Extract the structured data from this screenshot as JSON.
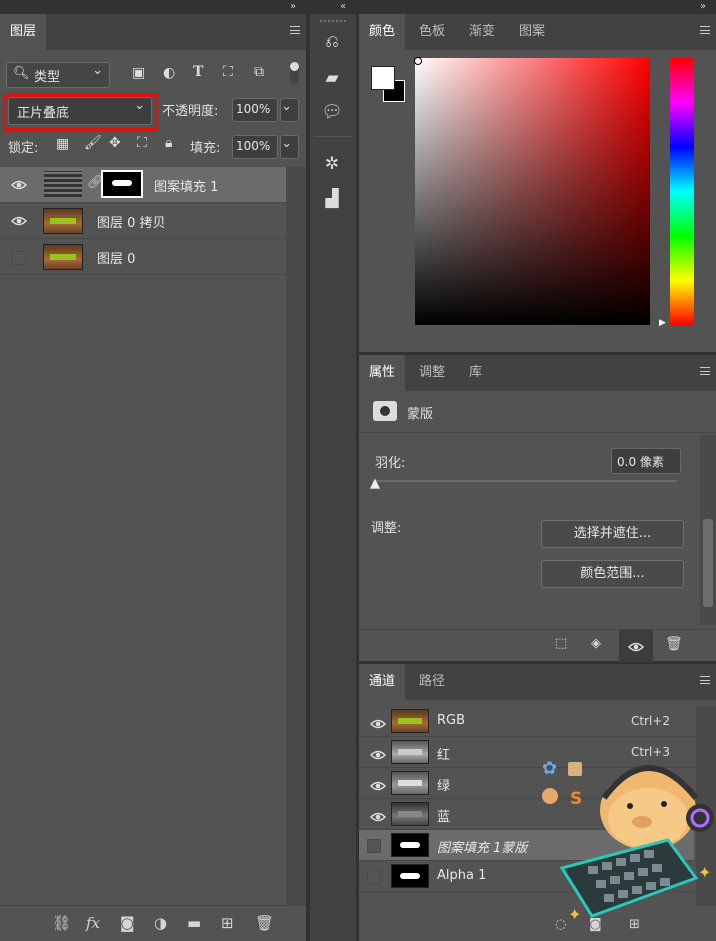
{
  "layers_panel": {
    "tab": "图层",
    "filter": "类型",
    "blend_mode": "正片叠底",
    "opacity_label": "不透明度:",
    "opacity": "100%",
    "lock_label": "锁定:",
    "fill_label": "填充:",
    "fill": "100%",
    "layers": [
      {
        "name": "图案填充 1",
        "visible": true
      },
      {
        "name": "图层 0 拷贝",
        "visible": true
      },
      {
        "name": "图层 0",
        "visible": false
      }
    ]
  },
  "color_panel": {
    "tabs": [
      "颜色",
      "色板",
      "渐变",
      "图案"
    ]
  },
  "props_panel": {
    "tabs": [
      "属性",
      "调整",
      "库"
    ],
    "mask_label": "蒙版",
    "feather_label": "羽化:",
    "feather_value": "0.0 像素",
    "adjust_label": "调整:",
    "select_mask_btn": "选择并遮住...",
    "color_range_btn": "颜色范围..."
  },
  "channels_panel": {
    "tabs": [
      "通道",
      "路径"
    ],
    "channels": [
      {
        "name": "RGB",
        "shortcut": "Ctrl+2"
      },
      {
        "name": "红",
        "shortcut": "Ctrl+3"
      },
      {
        "name": "绿",
        "shortcut": ""
      },
      {
        "name": "蓝",
        "shortcut": ""
      },
      {
        "name": "图案填充 1蒙版",
        "shortcut": ""
      },
      {
        "name": "Alpha 1",
        "shortcut": ""
      }
    ]
  },
  "colors": {
    "highlight": "#e01010",
    "panel": "#535353",
    "tabbar": "#424242"
  }
}
